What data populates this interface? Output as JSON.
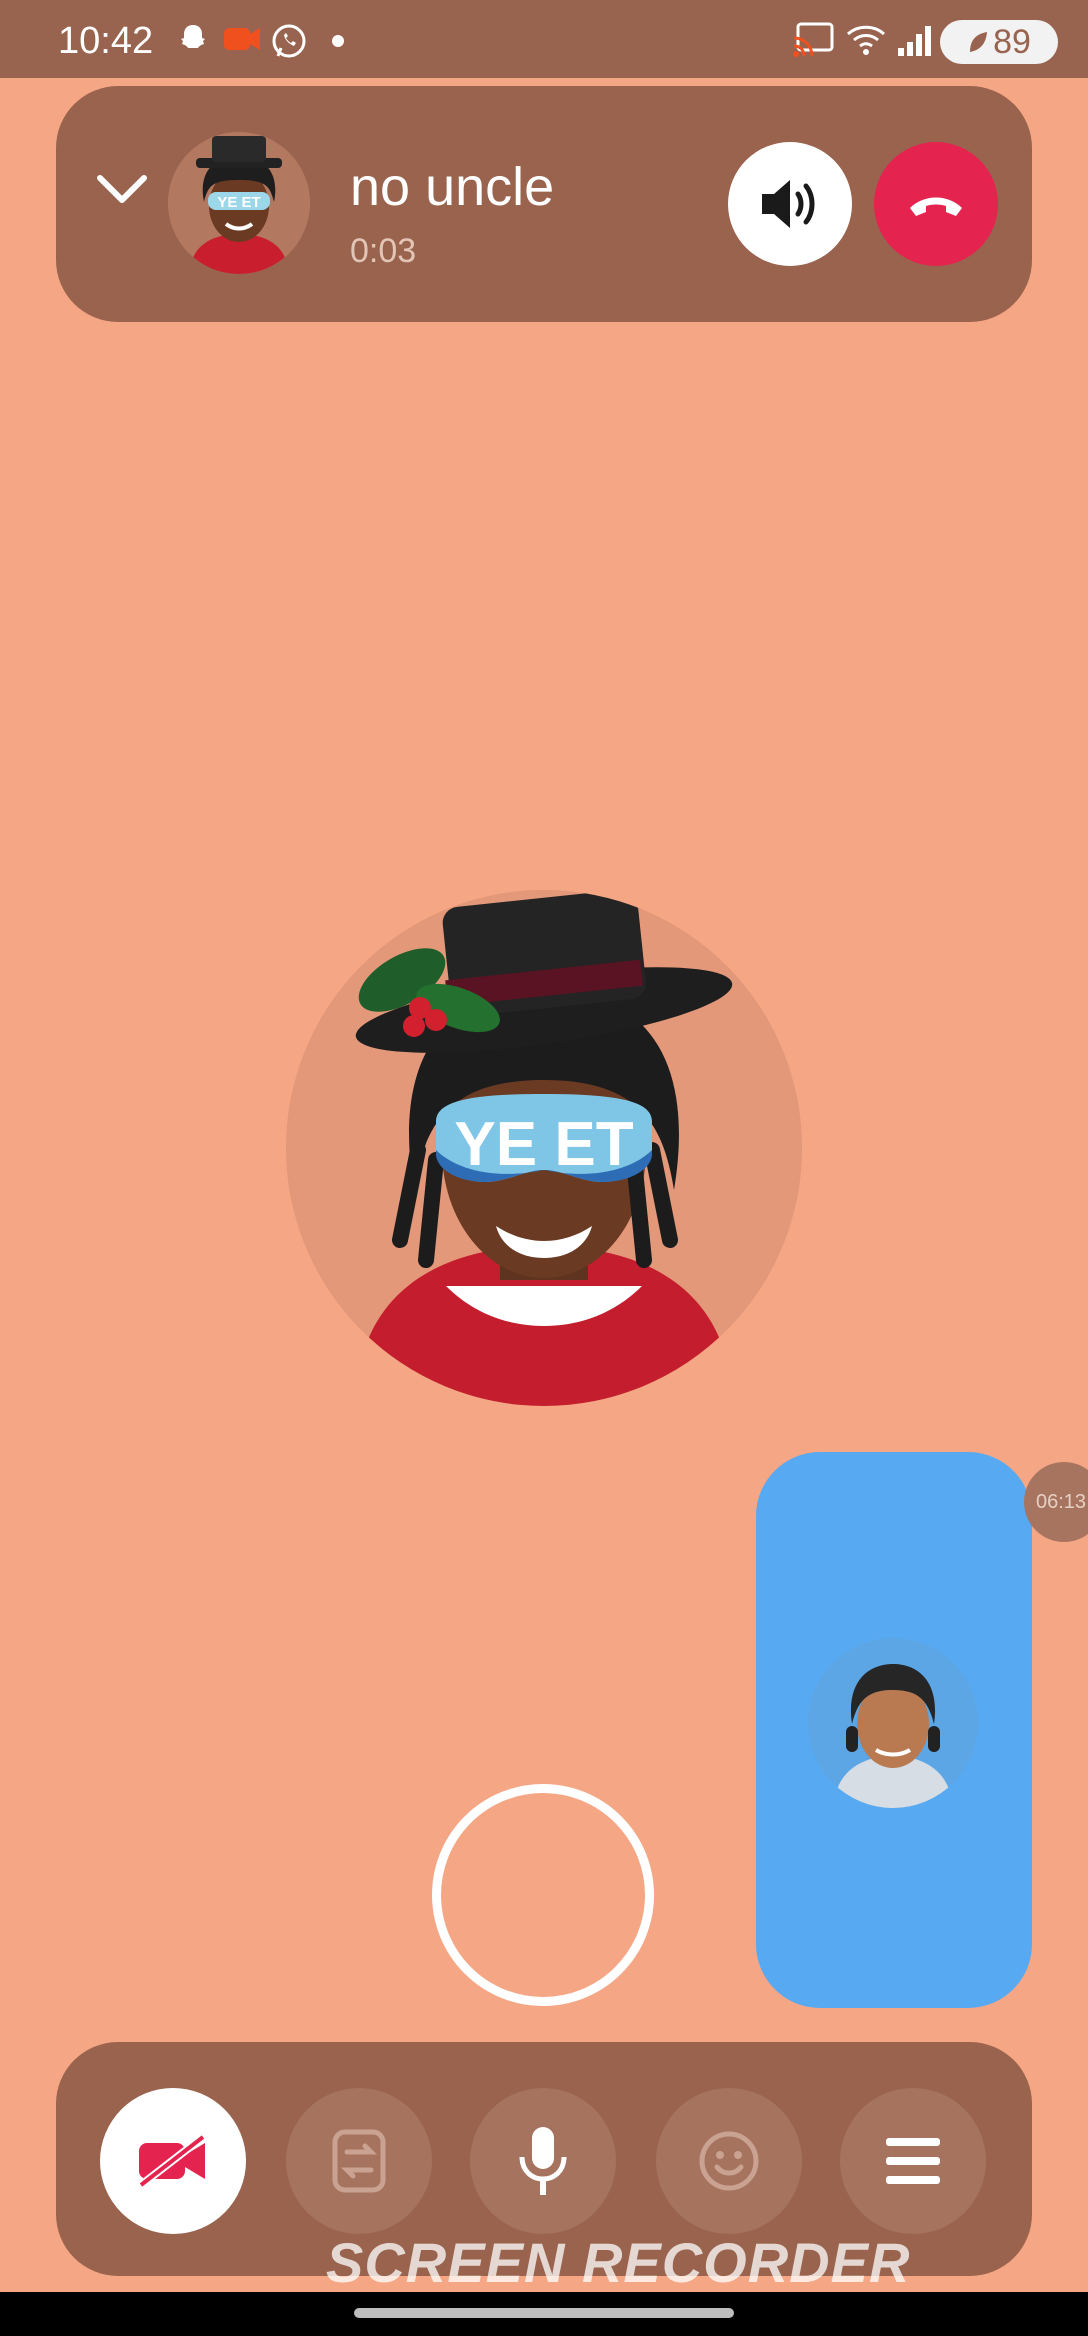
{
  "status_bar": {
    "time": "10:42",
    "battery": "89",
    "icons": [
      "snapchat-icon",
      "record-icon",
      "whatsapp-icon",
      "dot-icon",
      "cast-icon",
      "wifi-icon",
      "signal-icon",
      "battery-icon"
    ]
  },
  "call": {
    "caller_name": "no uncle",
    "duration": "0:03",
    "avatar_text": "YE ET"
  },
  "self_view": {
    "side_badge": "06:13"
  },
  "controls": {
    "buttons": [
      "video-off-icon",
      "flip-camera-icon",
      "mic-icon",
      "emoji-icon",
      "menu-icon"
    ]
  },
  "watermark": "SCREEN RECORDER",
  "colors": {
    "background": "#F5A684",
    "panel": "#99634E",
    "end_call": "#E5234F",
    "self_view": "#57AAF1"
  }
}
